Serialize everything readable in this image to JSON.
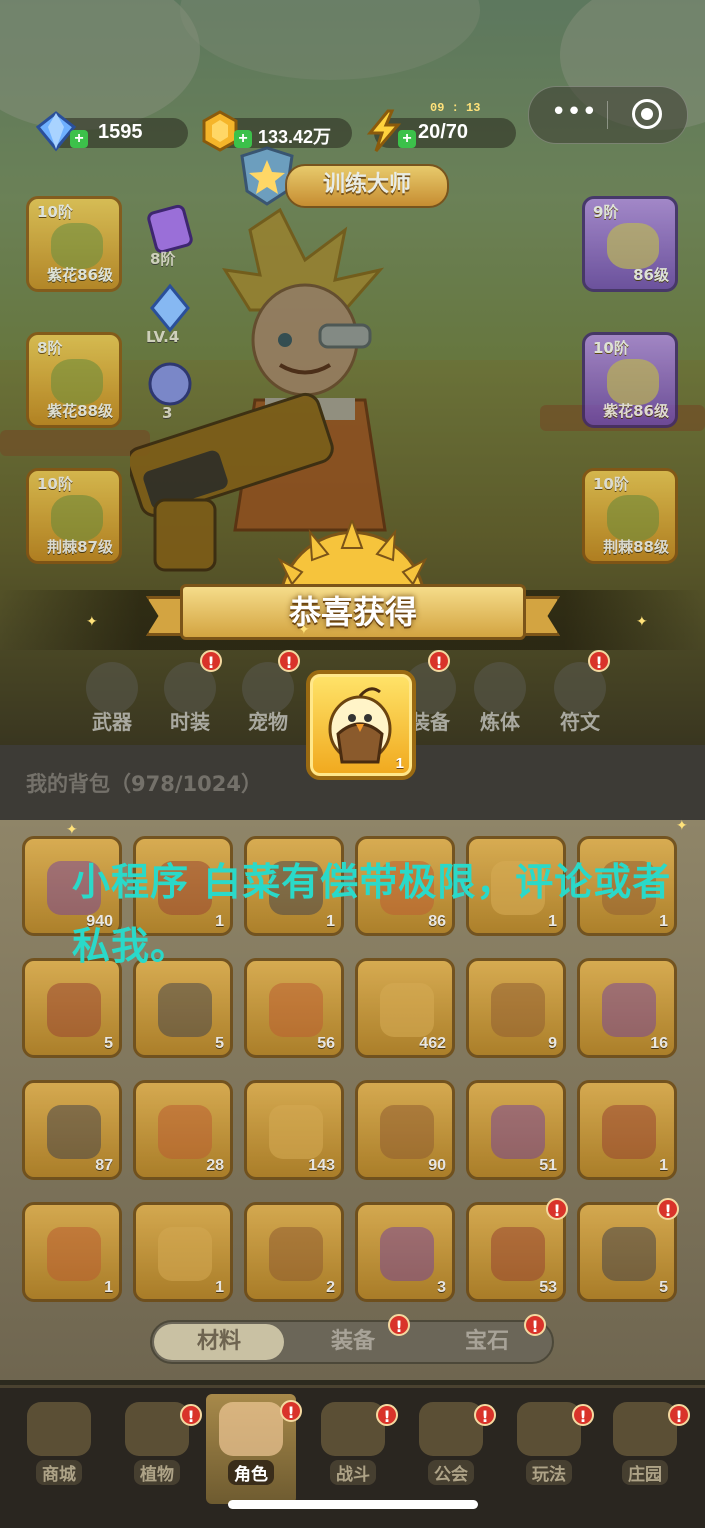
{
  "resources": {
    "gems": "1595",
    "gold": "133.42万",
    "energy": "20/70",
    "energy_timer": "09 : 13"
  },
  "miniprogram_capsule": {
    "more_icon": "more-dots-icon",
    "close_icon": "target-circle-icon"
  },
  "title_badge": "训练大师",
  "equipment_left": [
    {
      "tier": "10阶",
      "level": "紫花86级",
      "color": "gold"
    },
    {
      "tier": "8阶",
      "level": "紫花88级",
      "color": "gold"
    },
    {
      "tier": "10阶",
      "level": "荆棘87级",
      "color": "gold"
    }
  ],
  "equipment_right": [
    {
      "tier": "9阶",
      "level": "86级",
      "color": "purple"
    },
    {
      "tier": "10阶",
      "level": "紫花86级",
      "color": "purple"
    },
    {
      "tier": "10阶",
      "level": "荆棘88级",
      "color": "gold"
    }
  ],
  "side_small": [
    {
      "label": "8阶"
    },
    {
      "label": "LV.4"
    },
    {
      "label": "3"
    }
  ],
  "categories": [
    {
      "label": "武器",
      "alert": false
    },
    {
      "label": "时装",
      "alert": true
    },
    {
      "label": "宠物",
      "alert": true
    },
    {
      "label": "装备",
      "alert": true
    },
    {
      "label": "炼体",
      "alert": false
    },
    {
      "label": "符文",
      "alert": true
    }
  ],
  "bag": {
    "title": "我的背包（978/1024）",
    "rows": [
      [
        "940",
        "1",
        "1",
        "86",
        "1",
        "1"
      ],
      [
        "5",
        "5",
        "56",
        "462",
        "9",
        "16"
      ],
      [
        "87",
        "28",
        "143",
        "90",
        "51",
        "1"
      ],
      [
        "1",
        "1",
        "2",
        "3",
        "53",
        "5"
      ]
    ]
  },
  "bag_tabs": [
    {
      "label": "材料",
      "active": true,
      "alert": false
    },
    {
      "label": "装备",
      "active": false,
      "alert": true
    },
    {
      "label": "宝石",
      "active": false,
      "alert": true
    }
  ],
  "bottom_nav": [
    {
      "label": "商城",
      "active": false,
      "alert": false
    },
    {
      "label": "植物",
      "active": false,
      "alert": true
    },
    {
      "label": "角色",
      "active": true,
      "alert": true
    },
    {
      "label": "战斗",
      "active": false,
      "alert": true
    },
    {
      "label": "公会",
      "active": false,
      "alert": true
    },
    {
      "label": "玩法",
      "active": false,
      "alert": true
    },
    {
      "label": "庄园",
      "active": false,
      "alert": true
    }
  ],
  "popup": {
    "title": "恭喜获得",
    "reward_count": "1",
    "reward_icon": "chick-pet-icon"
  },
  "overlay_note": "小程序 白菜有偿带极限，评论或者私我。",
  "colors": {
    "note_text": "#2ad9c9",
    "alert_red": "#d9332a",
    "gold": "#f0a81d",
    "purple": "#6d47b4"
  }
}
